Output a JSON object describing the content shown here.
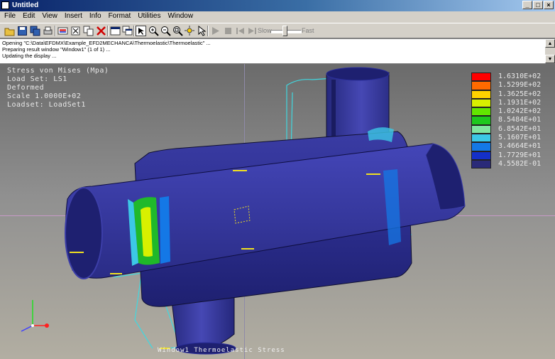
{
  "window": {
    "title": "Untitled"
  },
  "menubar": {
    "items": [
      "File",
      "Edit",
      "View",
      "Insert",
      "Info",
      "Format",
      "Utilities",
      "Window"
    ]
  },
  "toolbar": {
    "buttons": [
      "open-icon",
      "save-icon",
      "save-all-icon",
      "print-icon",
      "show-result-icon",
      "export-icon",
      "copy-icon",
      "close-icon",
      "window-icon",
      "cascade-icon",
      "select-icon",
      "zoom-in-icon",
      "zoom-out-icon",
      "zoom-fit-icon",
      "spin-icon",
      "pointer-icon",
      "play-icon",
      "stop-icon",
      "step-back-icon",
      "step-forward-icon"
    ],
    "speed": {
      "slow_label": "Slow",
      "fast_label": "Fast",
      "value": 0.45
    }
  },
  "messages": [
    "Opening \"C:\\Data\\EFDMX\\Example_EFD2MECHANCA\\Thermoelastic\\Thermoelastic\" ...",
    "Preparing result window \"Window1\" (1 of 1) ...",
    "Updating the display ..."
  ],
  "viewport": {
    "info_lines": [
      "Stress von Mises (Mpa)",
      "Load Set: LS1",
      "Deformed",
      "Scale 1.0000E+02",
      "Loadset: LoadSet1"
    ],
    "legend": {
      "values": [
        "1.6310E+02",
        "1.5299E+02",
        "1.3625E+02",
        "1.1931E+02",
        "1.0242E+02",
        "8.5484E+01",
        "6.8542E+01",
        "5.1607E+01",
        "3.4664E+01",
        "1.7729E+01",
        "4.5582E-01"
      ],
      "colors": [
        "#ff0000",
        "#ff6a00",
        "#ffd200",
        "#d8f000",
        "#62e600",
        "#1ec81e",
        "#80e6a0",
        "#3cc8e6",
        "#1478e6",
        "#1430c8",
        "#2a2a78"
      ]
    },
    "footer_text": "Window1   Thermoelastic   Stress"
  },
  "colors": {
    "title_start": "#0a246a",
    "title_end": "#a6caf0",
    "chrome": "#d4d0c8",
    "model_base": "#2c2e8e"
  }
}
